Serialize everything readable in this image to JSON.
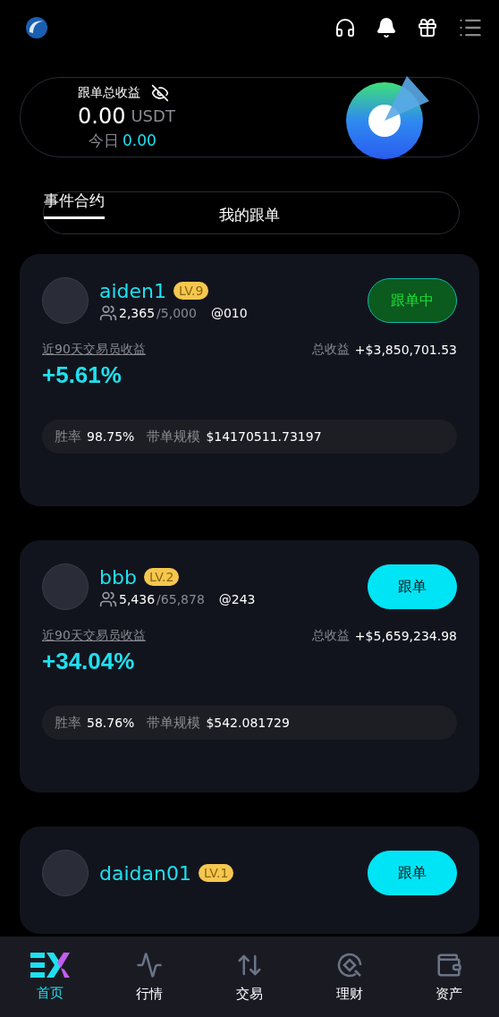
{
  "summary": {
    "title": "跟单总收益",
    "amount": "0.00",
    "unit": "USDT",
    "today_label": "今日",
    "today_value": "0.00"
  },
  "tabs": [
    {
      "label": "事件合约",
      "selected": true
    },
    {
      "label": "我的跟单",
      "selected": false
    }
  ],
  "traders": [
    {
      "name": "aiden1",
      "level": "LV.9",
      "followers": "2,365",
      "capacity": "/5,000",
      "handle": "@010",
      "button": {
        "label": "跟单中",
        "kind": "following"
      },
      "return_label": "近90天交易员收益",
      "return_value": "+5.61%",
      "total_label": "总收益",
      "total_value": "+$3,850,701.53",
      "win_label": "胜率",
      "win_value": "98.75%",
      "scale_label": "带单规模",
      "scale_value": "$14170511.73197"
    },
    {
      "name": "bbb",
      "level": "LV.2",
      "followers": "5,436",
      "capacity": "/65,878",
      "handle": "@243",
      "button": {
        "label": "跟单",
        "kind": "follow"
      },
      "return_label": "近90天交易员收益",
      "return_value": "+34.04%",
      "total_label": "总收益",
      "total_value": "+$5,659,234.98",
      "win_label": "胜率",
      "win_value": "58.76%",
      "scale_label": "带单规模",
      "scale_value": "$542.081729"
    },
    {
      "name": "daidan01",
      "level": "LV.1",
      "button": {
        "label": "跟单",
        "kind": "follow"
      }
    }
  ],
  "bottom_nav": [
    {
      "label": "首页",
      "kind": "home",
      "selected": true
    },
    {
      "label": "行情",
      "kind": "market",
      "selected": false
    },
    {
      "label": "交易",
      "kind": "trade",
      "selected": false
    },
    {
      "label": "理财",
      "kind": "finance",
      "selected": false
    },
    {
      "label": "资产",
      "kind": "assets",
      "selected": false
    }
  ]
}
